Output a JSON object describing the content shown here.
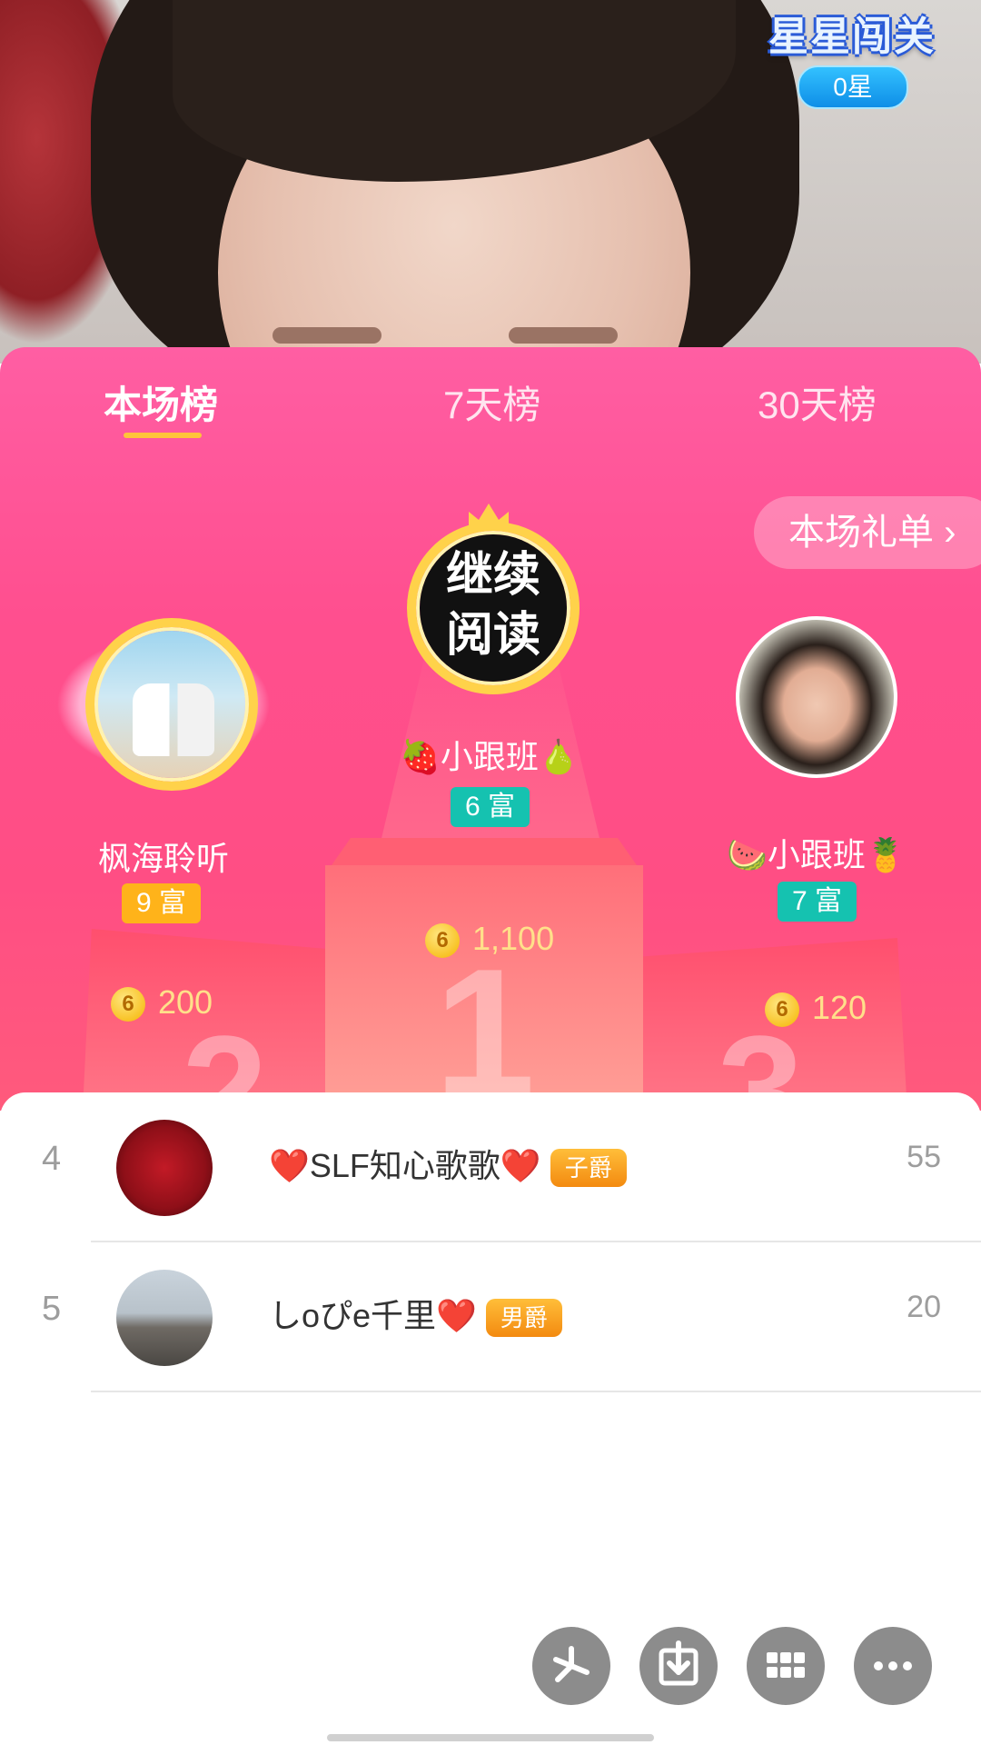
{
  "stream": {
    "badge_title": "星星闯关",
    "stars_count": "0星"
  },
  "tabs": [
    {
      "label": "本场榜",
      "active": true
    },
    {
      "label": "7天榜",
      "active": false
    },
    {
      "label": "30天榜",
      "active": false
    }
  ],
  "gift_list_button": "本场礼单 ›",
  "top3": {
    "first": {
      "avatar_text": "继续\n阅读",
      "name": "🍓小跟班🍐",
      "rich": "6 富",
      "coins": "1,100"
    },
    "second": {
      "name": "枫海聆听",
      "rich": "9 富",
      "coins": "200"
    },
    "third": {
      "name": "🍉小跟班🍍",
      "rich": "7 富",
      "coins": "120"
    }
  },
  "podium_numbers": [
    "1",
    "2",
    "3"
  ],
  "list": [
    {
      "rank": "4",
      "name": "❤️SLF知心歌歌❤️",
      "title": "子爵",
      "score": "55"
    },
    {
      "rank": "5",
      "name": "しoぴe千里❤️",
      "title": "男爵",
      "score": "20"
    }
  ],
  "fab_icons": [
    "pinwheel-icon",
    "download-icon",
    "grid-icon",
    "more-icon"
  ]
}
